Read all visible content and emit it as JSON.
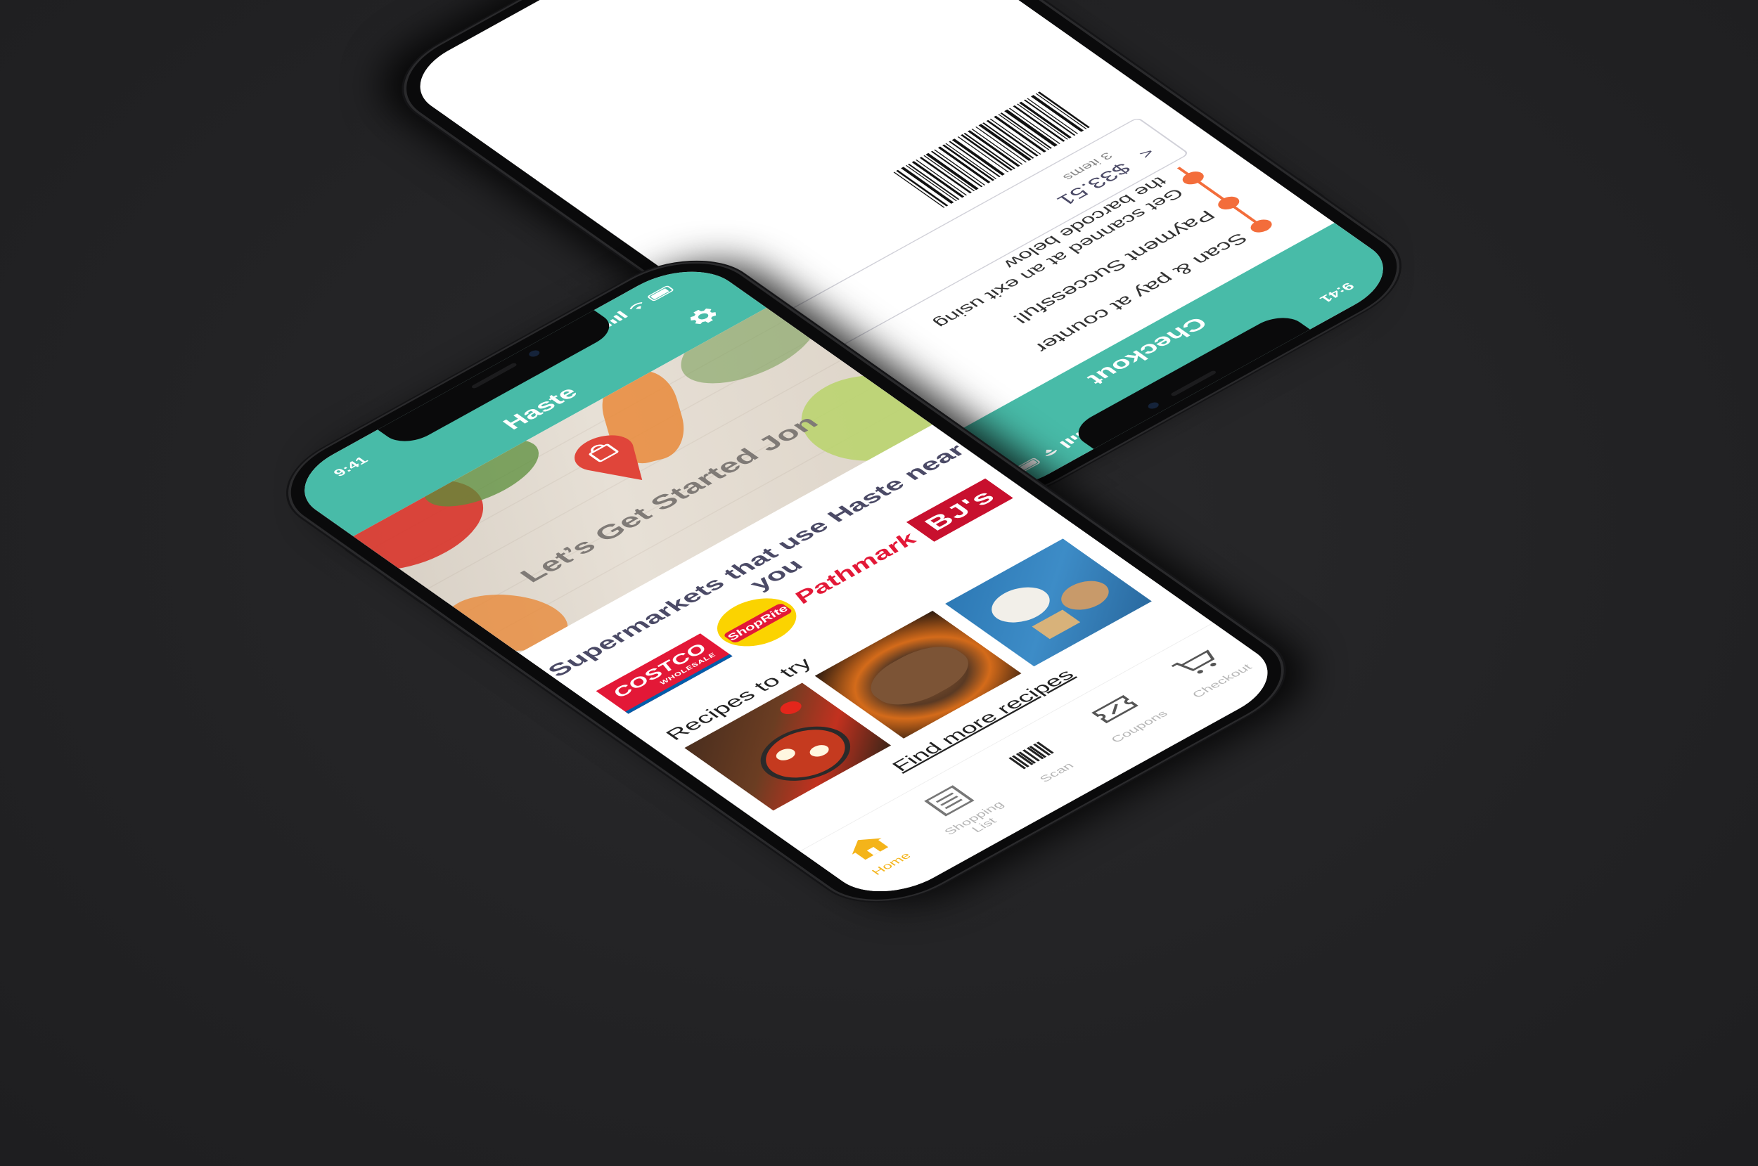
{
  "main_app": {
    "status_time": "9:41",
    "title": "Haste",
    "hero_text": "Let’s Get Started Jon",
    "supermarkets_title": "Supermarkets that use Haste near you",
    "supermarkets": [
      {
        "name": "COSTCO",
        "sub": "WHOLESALE"
      },
      {
        "name": "ShopRite"
      },
      {
        "name": "Pathmark"
      },
      {
        "name": "BJ's"
      }
    ],
    "recipes_title": "Recipes to try",
    "find_more": "Find more recipes",
    "tabs": [
      {
        "label": "Home",
        "icon": "home-icon",
        "active": true
      },
      {
        "label": "Shopping List",
        "icon": "list-icon",
        "active": false
      },
      {
        "label": "Scan",
        "icon": "barcode-icon",
        "active": false
      },
      {
        "label": "Coupons",
        "icon": "coupon-icon",
        "active": false
      },
      {
        "label": "Checkout",
        "icon": "cart-icon",
        "active": false
      }
    ]
  },
  "checkout_app": {
    "status_time": "9:41",
    "title": "Checkout",
    "steps": [
      "Scan & pay at counter",
      "Payment Successful!",
      "Get scanned at an exit using",
      "the barcode below"
    ],
    "summary_amount": "$33.51",
    "summary_items": "3 items",
    "summary_chevron": "<"
  },
  "colors": {
    "brand_teal": "#48bba8",
    "active_tab": "#f4b41a",
    "step_orange": "#f36d3b",
    "heading": "#4b4a66"
  }
}
